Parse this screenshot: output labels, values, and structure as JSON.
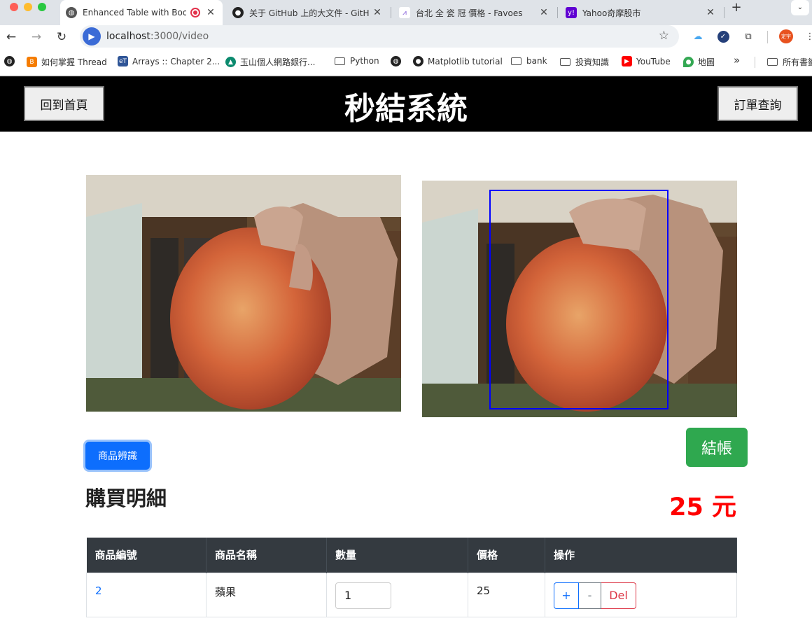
{
  "browser": {
    "tabs": [
      {
        "title": "Enhanced Table with Boot",
        "active": true
      },
      {
        "title": "关于 GitHub 上的大文件 - GitH",
        "active": false
      },
      {
        "title": "台北 全 瓷 冠 價格 - Favoes",
        "active": false
      },
      {
        "title": "Yahoo奇摩股市",
        "active": false
      }
    ],
    "new_tab": "+",
    "url_host": "localhost",
    "url_path": ":3000/video",
    "profile_label": "定宇",
    "bookmarks": [
      "如何掌握 Thread",
      "Arrays :: Chapter 2...",
      "玉山個人網路銀行...",
      "Python",
      "Matplotlib tutorial",
      "bank",
      "投資知識",
      "YouTube",
      "地圖"
    ],
    "bookmarks_overflow": "»",
    "all_bookmarks": "所有書籤"
  },
  "header": {
    "title": "秒結系統",
    "home_button": "回到首頁",
    "orders_button": "訂單查詢"
  },
  "main": {
    "recognize_button": "商品辨識",
    "checkout_button": "結帳",
    "section_title": "購買明細",
    "total": "25 元"
  },
  "table": {
    "columns": [
      "商品編號",
      "商品名稱",
      "數量",
      "價格",
      "操作"
    ],
    "rows": [
      {
        "id": "2",
        "name": "蘋果",
        "qty": "1",
        "price": "25"
      }
    ],
    "action_labels": {
      "plus": "+",
      "minus": "-",
      "del": "Del"
    }
  },
  "colors": {
    "header_bg": "#000000",
    "primary": "#0d6efd",
    "success": "#2fa84f",
    "total": "#ff0000",
    "detect_box": "#0000ff"
  }
}
